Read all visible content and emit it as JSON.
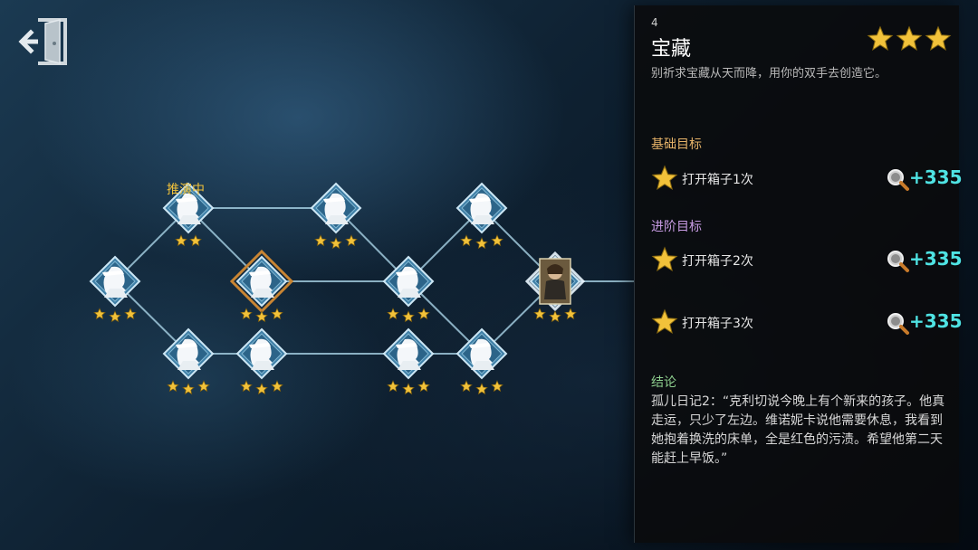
{
  "map": {
    "current_label": "推演中",
    "nodes": [
      {
        "id": "n1",
        "stars": 3
      },
      {
        "id": "n2",
        "stars": 2,
        "current": true
      },
      {
        "id": "n3",
        "stars": 3
      },
      {
        "id": "n4",
        "stars": 3,
        "highlighted": true
      },
      {
        "id": "n5",
        "stars": 3
      },
      {
        "id": "n6",
        "stars": 3
      },
      {
        "id": "n7",
        "stars": 3
      },
      {
        "id": "n8",
        "stars": 3
      },
      {
        "id": "n9",
        "stars": 3
      },
      {
        "id": "n10",
        "stars": 3
      },
      {
        "id": "n11",
        "stars": 3
      },
      {
        "id": "n12",
        "stars": 3,
        "selected": true,
        "portrait": true
      }
    ]
  },
  "panel": {
    "number": "4",
    "title": "宝藏",
    "stars": 3,
    "description": "别祈求宝藏从天而降，用你的双手去创造它。",
    "basic_label": "基础目标",
    "advanced_label": "进阶目标",
    "conclusion_label": "结论",
    "objectives": [
      {
        "text": "打开箱子1次",
        "points": "+335"
      },
      {
        "text": "打开箱子2次",
        "points": "+335"
      },
      {
        "text": "打开箱子3次",
        "points": "+335"
      }
    ],
    "conclusion_text": "孤儿日记2：“克利切说今晚上有个新来的孩子。他真走运，只少了左边。维诺妮卡说他需要休息，我看到她抱着换洗的床单，全是红色的污渍。希望他第二天能赶上早饭。”"
  },
  "colors": {
    "star": "#f2c23a",
    "points": "#4fe3e3",
    "basic": "#e7b469",
    "advanced": "#c79be3",
    "conclusion": "#8fd08f"
  },
  "icons": {
    "exit": "exit-door-icon",
    "node": "detective-silhouette-icon",
    "points": "magnifier-icon",
    "objective": "star-icon"
  }
}
